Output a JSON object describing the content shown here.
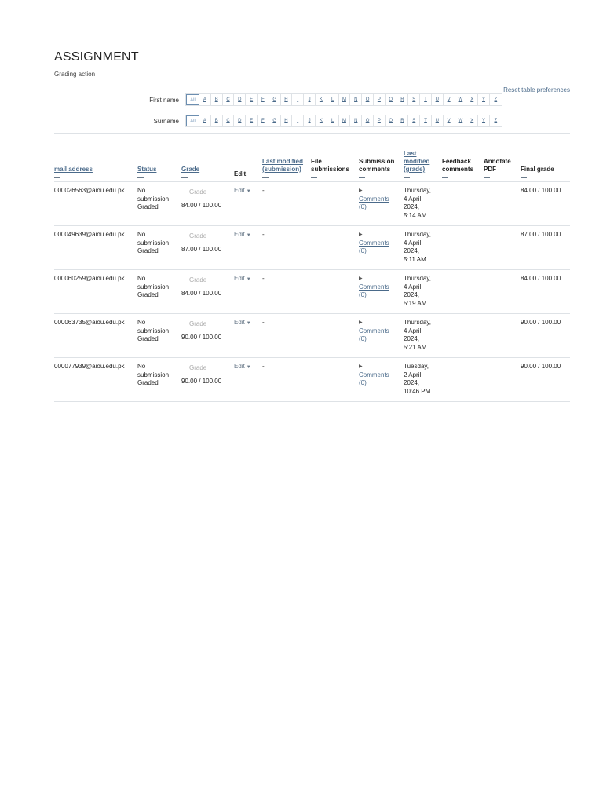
{
  "header": {
    "title": "ASSIGNMENT",
    "subtitle": "Grading action",
    "reset_link": "Reset table preferences"
  },
  "filters": {
    "first_name_label": "First name",
    "surname_label": "Surname",
    "all_label": "All",
    "letters": [
      "A",
      "B",
      "C",
      "D",
      "E",
      "F",
      "G",
      "H",
      "I",
      "J",
      "K",
      "L",
      "M",
      "N",
      "O",
      "P",
      "Q",
      "R",
      "S",
      "T",
      "U",
      "V",
      "W",
      "X",
      "Y",
      "Z"
    ]
  },
  "table": {
    "columns": [
      {
        "label": "mail address",
        "sortable": true
      },
      {
        "label": "Status",
        "sortable": true
      },
      {
        "label": "Grade",
        "sortable": true
      },
      {
        "label": "Edit",
        "sortable": false
      },
      {
        "label": "Last modified (submission)",
        "sortable": true
      },
      {
        "label": "File submissions",
        "sortable": false
      },
      {
        "label": "Submission comments",
        "sortable": false
      },
      {
        "label": "Last modified (grade)",
        "sortable": true
      },
      {
        "label": "Feedback comments",
        "sortable": false
      },
      {
        "label": "Annotate PDF",
        "sortable": false
      },
      {
        "label": "Final grade",
        "sortable": false
      }
    ],
    "grade_placeholder": "Grade",
    "edit_label": "Edit",
    "rows": [
      {
        "email": "000026563@aiou.edu.pk",
        "status": [
          "No",
          "submission",
          "Graded"
        ],
        "grade": "84.00 / 100.00",
        "last_modified_submission": "-",
        "comments": [
          "Comments",
          "(0)"
        ],
        "last_modified_grade": [
          "Thursday,",
          "4 April",
          "2024,",
          "5:14 AM"
        ],
        "final_grade": "84.00 / 100.00"
      },
      {
        "email": "000049639@aiou.edu.pk",
        "status": [
          "No",
          "submission",
          "Graded"
        ],
        "grade": "87.00 / 100.00",
        "last_modified_submission": "-",
        "comments": [
          "Comments",
          "(0)"
        ],
        "last_modified_grade": [
          "Thursday,",
          "4 April",
          "2024,",
          "5:11 AM"
        ],
        "final_grade": "87.00 / 100.00"
      },
      {
        "email": "000060259@aiou.edu.pk",
        "status": [
          "No",
          "submission",
          "Graded"
        ],
        "grade": "84.00 / 100.00",
        "last_modified_submission": "-",
        "comments": [
          "Comments",
          "(0)"
        ],
        "last_modified_grade": [
          "Thursday,",
          "4 April",
          "2024,",
          "5:19 AM"
        ],
        "final_grade": "84.00 / 100.00"
      },
      {
        "email": "000063735@aiou.edu.pk",
        "status": [
          "No",
          "submission",
          "Graded"
        ],
        "grade": "90.00 / 100.00",
        "last_modified_submission": "-",
        "comments": [
          "Comments",
          "(0)"
        ],
        "last_modified_grade": [
          "Thursday,",
          "4 April",
          "2024,",
          "5:21 AM"
        ],
        "final_grade": "90.00 / 100.00"
      },
      {
        "email": "000077939@aiou.edu.pk",
        "status": [
          "No",
          "submission",
          "Graded"
        ],
        "grade": "90.00 / 100.00",
        "last_modified_submission": "-",
        "comments": [
          "Comments",
          "(0)"
        ],
        "last_modified_grade": [
          "Tuesday,",
          "2 April",
          "2024,",
          "10:46 PM"
        ],
        "final_grade": "90.00 / 100.00"
      }
    ]
  },
  "colors": {
    "link": "#4a6a8a",
    "border": "#dee2e6",
    "text": "#222222"
  }
}
